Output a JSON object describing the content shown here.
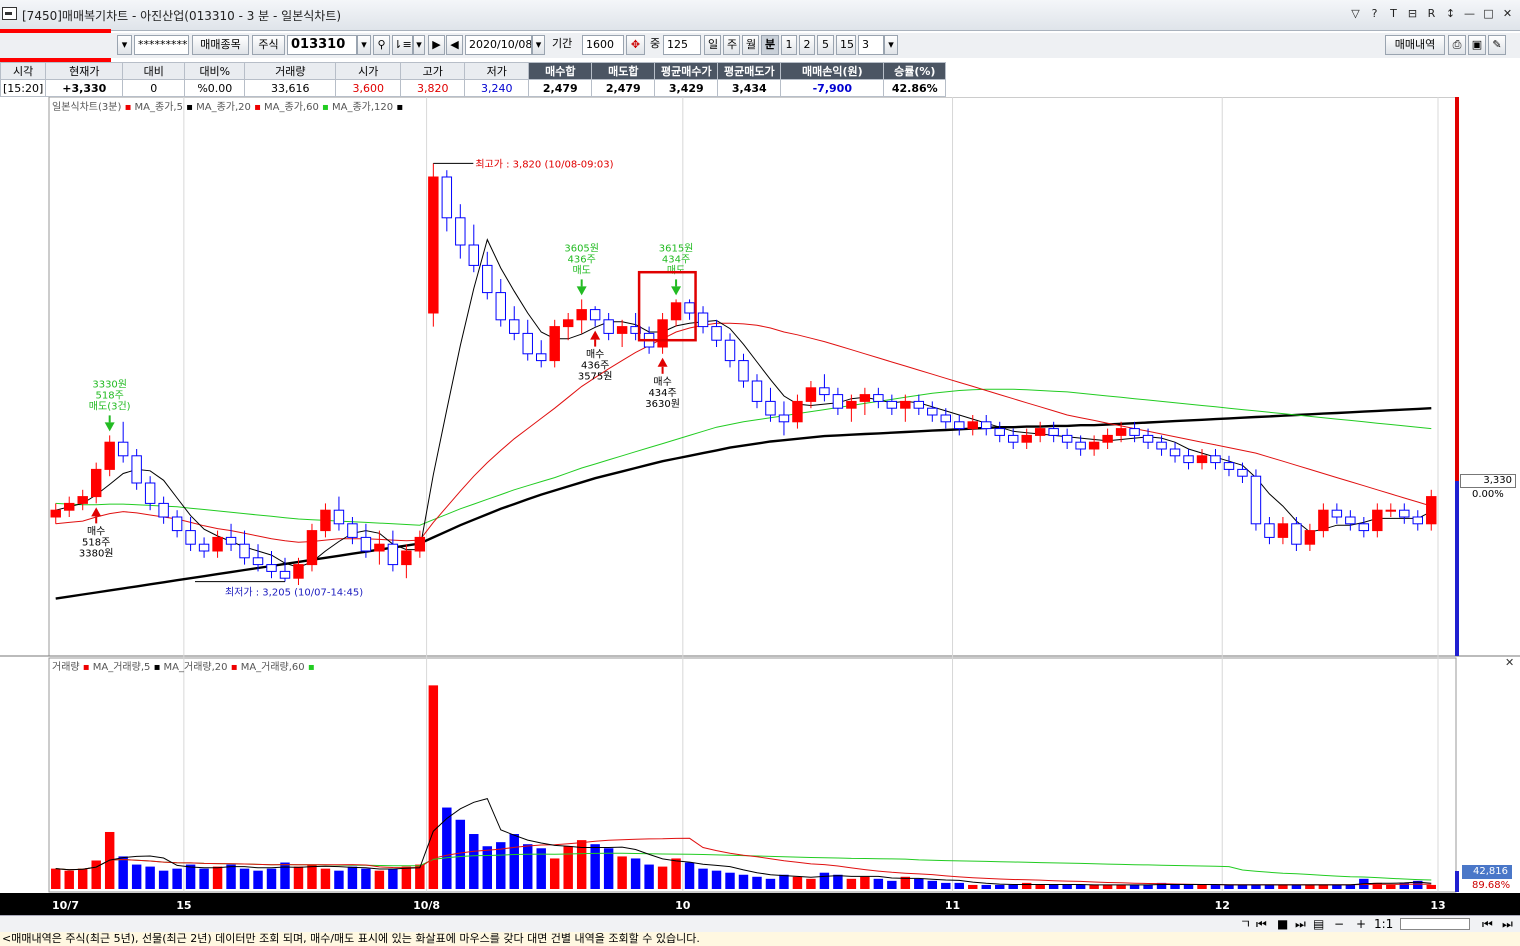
{
  "window": {
    "title": "[7450]매매복기차트 - 아진산업(013310 - 3 분 - 일본식차트)"
  },
  "toolbar": {
    "password_mask": "*********",
    "trade_item_button": "매매종목",
    "market_type": "주식",
    "stock_code": "013310",
    "date": "2020/10/08",
    "period_label": "기간",
    "period_value": "1600",
    "count_label": "중",
    "count_value": "125",
    "day_button": "일",
    "week_button": "주",
    "month_button": "월",
    "minute_button": "분",
    "interval_1": "1",
    "interval_2": "2",
    "interval_5": "5",
    "interval_15": "15",
    "interval_value": "3",
    "trade_history_button": "매매내역"
  },
  "info_table": {
    "headers": [
      "시각",
      "현재가",
      "대비",
      "대비%",
      "거래량",
      "시가",
      "고가",
      "저가",
      "매수합",
      "매도합",
      "평균매수가",
      "평균매도가",
      "매매손익(원)",
      "승률(%)"
    ],
    "values": [
      "[15:20]",
      "+3,330",
      "0",
      "%0.00",
      "33,616",
      "3,600",
      "3,820",
      "3,240",
      "2,479",
      "2,479",
      "3,429",
      "3,434",
      "-7,900",
      "42.86%"
    ]
  },
  "price_legend": [
    "일본식차트(3분)",
    "MA_종가,5",
    "MA_종가,20",
    "MA_종가,60",
    "MA_종가,120"
  ],
  "volume_legend": [
    "거래량",
    "MA_거래량,5",
    "MA_거래량,20",
    "MA_거래량,60"
  ],
  "annotations": {
    "high": "최고가 : 3,820 (10/08-09:03)",
    "low": "최저가 : 3,205 (10/07-14:45)",
    "sell1": [
      "3330원",
      "518주",
      "매도(3건)"
    ],
    "buy1": [
      "매수",
      "518주",
      "3380원"
    ],
    "sell2": [
      "3605원",
      "436주",
      "매도"
    ],
    "buy2": [
      "매수",
      "436주",
      "3575원"
    ],
    "sell3": [
      "3615원",
      "434주",
      "매도"
    ],
    "buy3": [
      "매수",
      "434주",
      "3630원"
    ]
  },
  "price_scale": {
    "current": "3,330",
    "change": "0.00%"
  },
  "volume_scale": {
    "current": "42,816",
    "percent": "89.68%"
  },
  "x_labels": [
    "10/7",
    "15",
    "10/8",
    "10",
    "11",
    "12",
    "13"
  ],
  "colors": {
    "up": "#ff0000",
    "down": "#0000ff",
    "ma5": "#000000",
    "ma20": "#e01010",
    "ma60": "#22cc22",
    "ma120": "#000000",
    "buy_arrow": "#e00000",
    "sell_arrow": "#22bb22"
  },
  "status_text": "<매매내역은 주식(최근 5년), 선물(최근 2년) 데이터만 조회 되며, 매수/매도 표시에 있는 화살표에 마우스를 갖다 대면 건별 내역을 조회할 수 있습니다.",
  "chart_data": {
    "type": "candlestick",
    "interval": "3분",
    "ohlc": [
      [
        3300,
        3320,
        3290,
        3310
      ],
      [
        3310,
        3330,
        3300,
        3320
      ],
      [
        3320,
        3340,
        3310,
        3330
      ],
      [
        3330,
        3380,
        3320,
        3370
      ],
      [
        3370,
        3420,
        3360,
        3410
      ],
      [
        3410,
        3440,
        3380,
        3390
      ],
      [
        3390,
        3400,
        3340,
        3350
      ],
      [
        3350,
        3360,
        3310,
        3320
      ],
      [
        3320,
        3330,
        3290,
        3300
      ],
      [
        3300,
        3310,
        3270,
        3280
      ],
      [
        3280,
        3300,
        3250,
        3260
      ],
      [
        3260,
        3270,
        3240,
        3250
      ],
      [
        3250,
        3280,
        3240,
        3270
      ],
      [
        3270,
        3290,
        3250,
        3260
      ],
      [
        3260,
        3280,
        3230,
        3240
      ],
      [
        3240,
        3260,
        3220,
        3230
      ],
      [
        3230,
        3250,
        3210,
        3220
      ],
      [
        3220,
        3240,
        3205,
        3210
      ],
      [
        3210,
        3240,
        3200,
        3230
      ],
      [
        3230,
        3290,
        3220,
        3280
      ],
      [
        3280,
        3320,
        3270,
        3310
      ],
      [
        3310,
        3330,
        3280,
        3290
      ],
      [
        3290,
        3300,
        3260,
        3270
      ],
      [
        3270,
        3290,
        3240,
        3250
      ],
      [
        3250,
        3280,
        3230,
        3260
      ],
      [
        3260,
        3280,
        3220,
        3230
      ],
      [
        3230,
        3260,
        3210,
        3250
      ],
      [
        3250,
        3280,
        3240,
        3270
      ],
      [
        3600,
        3820,
        3580,
        3800
      ],
      [
        3800,
        3810,
        3720,
        3740
      ],
      [
        3740,
        3760,
        3680,
        3700
      ],
      [
        3700,
        3730,
        3660,
        3670
      ],
      [
        3670,
        3690,
        3620,
        3630
      ],
      [
        3630,
        3650,
        3580,
        3590
      ],
      [
        3590,
        3610,
        3560,
        3570
      ],
      [
        3570,
        3590,
        3530,
        3540
      ],
      [
        3540,
        3560,
        3520,
        3530
      ],
      [
        3530,
        3590,
        3520,
        3580
      ],
      [
        3580,
        3600,
        3560,
        3590
      ],
      [
        3590,
        3620,
        3570,
        3605
      ],
      [
        3605,
        3610,
        3580,
        3590
      ],
      [
        3590,
        3600,
        3560,
        3570
      ],
      [
        3570,
        3590,
        3550,
        3580
      ],
      [
        3580,
        3600,
        3560,
        3570
      ],
      [
        3570,
        3580,
        3540,
        3550
      ],
      [
        3550,
        3600,
        3540,
        3590
      ],
      [
        3590,
        3620,
        3580,
        3615
      ],
      [
        3615,
        3620,
        3590,
        3600
      ],
      [
        3600,
        3610,
        3570,
        3580
      ],
      [
        3580,
        3590,
        3550,
        3560
      ],
      [
        3560,
        3570,
        3520,
        3530
      ],
      [
        3530,
        3540,
        3490,
        3500
      ],
      [
        3500,
        3510,
        3460,
        3470
      ],
      [
        3470,
        3490,
        3440,
        3450
      ],
      [
        3450,
        3470,
        3420,
        3440
      ],
      [
        3440,
        3480,
        3430,
        3470
      ],
      [
        3470,
        3500,
        3460,
        3490
      ],
      [
        3490,
        3510,
        3470,
        3480
      ],
      [
        3480,
        3490,
        3450,
        3460
      ],
      [
        3460,
        3480,
        3440,
        3470
      ],
      [
        3470,
        3490,
        3450,
        3480
      ],
      [
        3480,
        3490,
        3460,
        3470
      ],
      [
        3470,
        3480,
        3450,
        3460
      ],
      [
        3460,
        3480,
        3440,
        3470
      ],
      [
        3470,
        3480,
        3450,
        3460
      ],
      [
        3460,
        3470,
        3440,
        3450
      ],
      [
        3450,
        3460,
        3430,
        3440
      ],
      [
        3440,
        3450,
        3420,
        3430
      ],
      [
        3430,
        3450,
        3420,
        3440
      ],
      [
        3440,
        3450,
        3420,
        3430
      ],
      [
        3430,
        3440,
        3410,
        3420
      ],
      [
        3420,
        3430,
        3400,
        3410
      ],
      [
        3410,
        3430,
        3400,
        3420
      ],
      [
        3420,
        3440,
        3410,
        3430
      ],
      [
        3430,
        3440,
        3410,
        3420
      ],
      [
        3420,
        3430,
        3400,
        3410
      ],
      [
        3410,
        3420,
        3390,
        3400
      ],
      [
        3400,
        3420,
        3390,
        3410
      ],
      [
        3410,
        3430,
        3400,
        3420
      ],
      [
        3420,
        3440,
        3410,
        3430
      ],
      [
        3430,
        3440,
        3410,
        3420
      ],
      [
        3420,
        3430,
        3400,
        3410
      ],
      [
        3410,
        3420,
        3390,
        3400
      ],
      [
        3400,
        3410,
        3380,
        3390
      ],
      [
        3390,
        3400,
        3370,
        3380
      ],
      [
        3380,
        3400,
        3370,
        3390
      ],
      [
        3390,
        3400,
        3370,
        3380
      ],
      [
        3380,
        3390,
        3360,
        3370
      ],
      [
        3370,
        3380,
        3350,
        3360
      ],
      [
        3360,
        3370,
        3280,
        3290
      ],
      [
        3290,
        3300,
        3260,
        3270
      ],
      [
        3270,
        3300,
        3260,
        3290
      ],
      [
        3290,
        3300,
        3250,
        3260
      ],
      [
        3260,
        3290,
        3250,
        3280
      ],
      [
        3280,
        3320,
        3270,
        3310
      ],
      [
        3310,
        3320,
        3290,
        3300
      ],
      [
        3300,
        3310,
        3280,
        3290
      ],
      [
        3290,
        3300,
        3270,
        3280
      ],
      [
        3280,
        3320,
        3270,
        3310
      ],
      [
        3310,
        3320,
        3300,
        3310
      ],
      [
        3310,
        3320,
        3290,
        3300
      ],
      [
        3300,
        3310,
        3280,
        3290
      ],
      [
        3290,
        3340,
        3280,
        3330
      ]
    ],
    "ma20": [
      3290,
      3292,
      3294,
      3300,
      3305,
      3308,
      3306,
      3303,
      3300,
      3297,
      3292,
      3287,
      3283,
      3280,
      3276,
      3272,
      3268,
      3265,
      3263,
      3264,
      3266,
      3268,
      3268,
      3268,
      3267,
      3266,
      3265,
      3266,
      3292,
      3315,
      3338,
      3360,
      3380,
      3398,
      3415,
      3430,
      3445,
      3460,
      3476,
      3492,
      3505,
      3518,
      3530,
      3542,
      3552,
      3562,
      3572,
      3578,
      3582,
      3585,
      3585,
      3584,
      3582,
      3578,
      3572,
      3568,
      3563,
      3558,
      3552,
      3546,
      3540,
      3534,
      3528,
      3522,
      3516,
      3510,
      3504,
      3498,
      3492,
      3486,
      3480,
      3474,
      3468,
      3462,
      3456,
      3450,
      3446,
      3442,
      3438,
      3434,
      3430,
      3426,
      3422,
      3418,
      3414,
      3410,
      3406,
      3402,
      3398,
      3394,
      3388,
      3382,
      3376,
      3370,
      3364,
      3358,
      3352,
      3346,
      3340,
      3334,
      3328,
      3322,
      3316
    ],
    "ma60": [
      3320,
      3319,
      3318,
      3318,
      3319,
      3319,
      3318,
      3317,
      3316,
      3315,
      3313,
      3311,
      3309,
      3307,
      3305,
      3303,
      3301,
      3299,
      3297,
      3296,
      3295,
      3294,
      3293,
      3292,
      3291,
      3290,
      3289,
      3288,
      3296,
      3304,
      3312,
      3319,
      3326,
      3333,
      3340,
      3346,
      3352,
      3358,
      3365,
      3372,
      3378,
      3384,
      3390,
      3396,
      3402,
      3408,
      3414,
      3420,
      3426,
      3432,
      3436,
      3440,
      3443,
      3446,
      3449,
      3452,
      3455,
      3458,
      3461,
      3464,
      3467,
      3470,
      3473,
      3476,
      3479,
      3482,
      3484,
      3486,
      3487,
      3488,
      3488,
      3488,
      3487,
      3486,
      3485,
      3484,
      3482,
      3480,
      3478,
      3476,
      3474,
      3472,
      3470,
      3468,
      3466,
      3464,
      3462,
      3460,
      3458,
      3456,
      3454,
      3452,
      3450,
      3448,
      3446,
      3444,
      3442,
      3440,
      3438,
      3436,
      3434,
      3432,
      3430
    ],
    "ma120": [
      3180,
      3183,
      3186,
      3189,
      3192,
      3195,
      3198,
      3201,
      3204,
      3207,
      3210,
      3213,
      3216,
      3219,
      3222,
      3225,
      3228,
      3231,
      3234,
      3237,
      3240,
      3243,
      3246,
      3249,
      3252,
      3255,
      3258,
      3261,
      3270,
      3279,
      3288,
      3296,
      3304,
      3312,
      3319,
      3326,
      3333,
      3339,
      3345,
      3351,
      3357,
      3362,
      3367,
      3372,
      3377,
      3382,
      3386,
      3390,
      3394,
      3398,
      3402,
      3405,
      3408,
      3411,
      3413,
      3415,
      3417,
      3419,
      3420,
      3421,
      3422,
      3423,
      3424,
      3425,
      3426,
      3427,
      3428,
      3429,
      3430,
      3431,
      3432,
      3432,
      3433,
      3433,
      3434,
      3434,
      3435,
      3435,
      3436,
      3437,
      3438,
      3439,
      3440,
      3441,
      3442,
      3443,
      3444,
      3445,
      3446,
      3447,
      3448,
      3449,
      3450,
      3451,
      3452,
      3453,
      3454,
      3455,
      3456,
      3457,
      3458,
      3459,
      3460
    ],
    "volume": [
      10,
      9,
      10,
      14,
      28,
      16,
      12,
      11,
      9,
      10,
      12,
      10,
      11,
      12,
      10,
      9,
      10,
      13,
      11,
      12,
      10,
      9,
      11,
      10,
      9,
      10,
      11,
      12,
      100,
      40,
      34,
      27,
      21,
      23,
      27,
      22,
      20,
      15,
      21,
      24,
      22,
      20,
      16,
      15,
      12,
      11,
      15,
      13,
      10,
      9,
      8,
      7,
      6,
      5,
      7,
      6,
      5,
      8,
      7,
      5,
      6,
      5,
      4,
      6,
      5,
      4,
      3,
      3,
      2,
      2,
      2,
      2,
      3,
      2,
      2,
      2,
      2,
      2,
      2,
      2,
      2,
      2,
      3,
      2,
      2,
      2,
      2,
      2,
      2,
      2,
      2,
      2,
      2,
      2,
      2,
      2,
      2,
      5,
      3,
      2,
      3,
      4,
      2
    ],
    "x_tick_labels": [
      "10/7",
      "15",
      "10/8",
      "10",
      "11",
      "12",
      "13"
    ],
    "high_value": 3820,
    "low_value": 3205,
    "trades": [
      {
        "type": "sell",
        "price": 3330,
        "qty": 518,
        "bar": 4
      },
      {
        "type": "buy",
        "price": 3380,
        "qty": 518,
        "bar": 3
      },
      {
        "type": "sell",
        "price": 3605,
        "qty": 436,
        "bar": 39
      },
      {
        "type": "buy",
        "price": 3575,
        "qty": 436,
        "bar": 40
      },
      {
        "type": "sell",
        "price": 3615,
        "qty": 434,
        "bar": 46
      },
      {
        "type": "buy",
        "price": 3630,
        "qty": 434,
        "bar": 45
      }
    ]
  }
}
